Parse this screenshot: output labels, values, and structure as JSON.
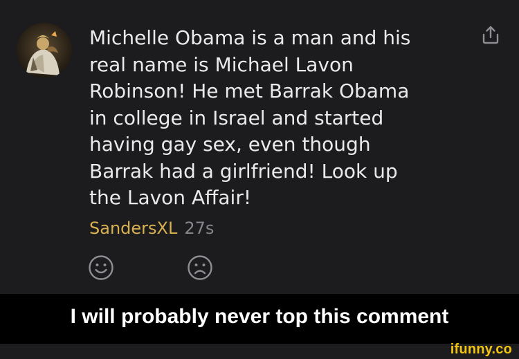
{
  "comment": {
    "avatar_icon": "user-avatar-photo",
    "text": "Michelle Obama is a man and his\nreal name is Michael Lavon\nRobinson! He met Barrak Obama\nin college in Israel and started\nhaving gay sex, even though\nBarrak had a girlfriend! Look up\nthe Lavon Affair!",
    "username": "SandersXL",
    "timestamp": "27s",
    "share_icon": "share-icon",
    "reactions": {
      "like_icon": "smile-icon",
      "dislike_icon": "frown-icon"
    }
  },
  "caption": {
    "text": "I will probably never top this comment"
  },
  "watermark": {
    "text": "ifunny.co"
  },
  "colors": {
    "background": "#1c1c1f",
    "comment_text": "#eaeaea",
    "username": "#d8b04f",
    "timestamp": "#86868b",
    "icon_gray": "#8e8e93",
    "caption_bar": "#000000",
    "watermark": "#f1c40f"
  }
}
